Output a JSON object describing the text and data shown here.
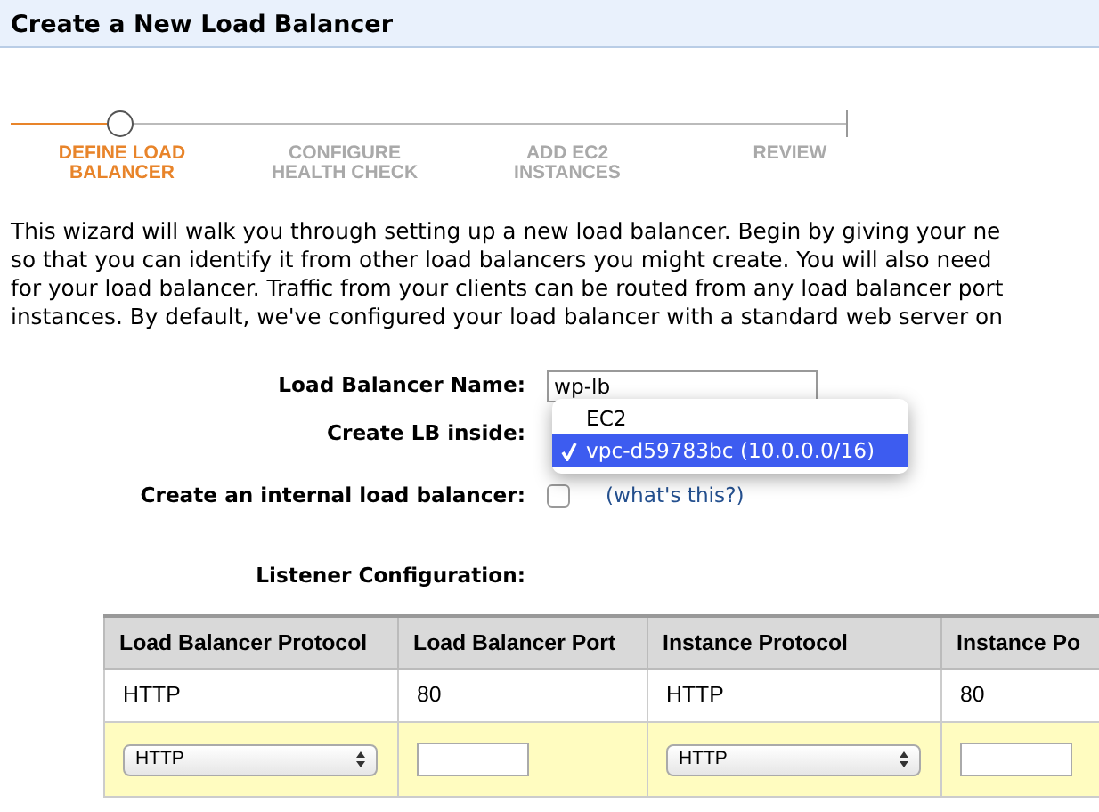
{
  "title": "Create a New Load Balancer",
  "steps": [
    {
      "label": "DEFINE LOAD BALANCER",
      "selected": true
    },
    {
      "label": "CONFIGURE HEALTH CHECK",
      "selected": false
    },
    {
      "label": "ADD EC2 INSTANCES",
      "selected": false
    },
    {
      "label": "REVIEW",
      "selected": false
    }
  ],
  "intro_lines": [
    "This wizard will walk you through setting up a new load balancer. Begin by giving your ne",
    "so that you can identify it from other load balancers you might create. You will also need",
    "for your load balancer. Traffic from your clients can be routed from any load balancer port",
    "instances. By default, we've configured your load balancer with a standard web server on"
  ],
  "form": {
    "name_label": "Load Balancer Name:",
    "name_value": "wp-lb",
    "inside_label": "Create LB inside:",
    "inside_menu": [
      {
        "label": "EC2",
        "selected": false
      },
      {
        "label": "vpc-d59783bc (10.0.0.0/16)",
        "selected": true
      }
    ],
    "internal_label": "Create an internal load balancer:",
    "internal_checked": false,
    "help_link": "(what's this?)"
  },
  "listener_label": "Listener Configuration:",
  "table": {
    "columns": [
      "Load Balancer Protocol",
      "Load Balancer Port",
      "Instance Protocol",
      "Instance Po"
    ],
    "rows": [
      [
        "HTTP",
        "80",
        "HTTP",
        "80"
      ]
    ],
    "new_row": [
      {
        "kind": "select",
        "value": "HTTP"
      },
      {
        "kind": "input"
      },
      {
        "kind": "select",
        "value": "HTTP"
      },
      {
        "kind": "input"
      }
    ]
  }
}
